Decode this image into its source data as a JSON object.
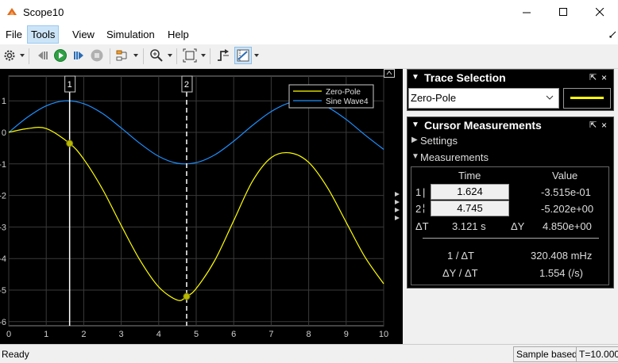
{
  "window": {
    "title": "Scope10"
  },
  "menu": [
    "File",
    "Tools",
    "View",
    "Simulation",
    "Help"
  ],
  "plot": {
    "legend": [
      "Zero-Pole",
      "Sine Wave4"
    ],
    "x_ticks": [
      "0",
      "1",
      "2",
      "3",
      "4",
      "5",
      "6",
      "7",
      "8",
      "9",
      "10"
    ],
    "y_ticks": [
      "1",
      "0",
      "-1",
      "-2",
      "-3",
      "-4",
      "-5",
      "-6"
    ],
    "cursor1_label": "1",
    "cursor2_label": "2",
    "series_colors": {
      "zero_pole": "#ffff00",
      "sine": "#1e90ff"
    }
  },
  "chart_data": {
    "type": "line",
    "xlim": [
      0,
      10
    ],
    "ylim": [
      -6.1,
      1.5
    ],
    "legend_position": "top-right",
    "grid": true,
    "series": [
      {
        "name": "Zero-Pole",
        "color": "#ffff00",
        "x": [
          0,
          0.5,
          1.0,
          1.624,
          2.0,
          2.5,
          3.0,
          3.5,
          4.0,
          4.5,
          4.745,
          5.0,
          5.5,
          6.0,
          6.5,
          7.0,
          7.5,
          8.0,
          8.5,
          9.0,
          9.5,
          10.0
        ],
        "values": [
          0,
          0.12,
          0.12,
          -0.35,
          -0.85,
          -1.8,
          -2.95,
          -4.05,
          -4.9,
          -5.32,
          -5.2,
          -4.95,
          -4.05,
          -2.8,
          -1.55,
          -0.8,
          -0.65,
          -0.95,
          -1.75,
          -2.85,
          -3.95,
          -4.8
        ]
      },
      {
        "name": "Sine Wave4",
        "color": "#1e90ff",
        "x": [
          0,
          0.5,
          1.0,
          1.5,
          2.0,
          2.5,
          3.0,
          3.5,
          4.0,
          4.5,
          5.0,
          5.5,
          6.0,
          6.5,
          7.0,
          7.5,
          8.0,
          8.5,
          9.0,
          9.5,
          10.0
        ],
        "values": [
          0,
          0.48,
          0.84,
          1.0,
          0.91,
          0.6,
          0.14,
          -0.35,
          -0.76,
          -0.98,
          -0.96,
          -0.71,
          -0.28,
          0.22,
          0.66,
          0.94,
          0.99,
          0.8,
          0.41,
          -0.08,
          -0.54
        ]
      }
    ],
    "cursors": [
      {
        "id": "1",
        "x": 1.624,
        "y": -0.3515
      },
      {
        "id": "2",
        "x": 4.745,
        "y": -5.202
      }
    ]
  },
  "trace_selection": {
    "title": "Trace Selection",
    "selected": "Zero-Pole",
    "color": "#ffff00"
  },
  "cursor_measurements": {
    "title": "Cursor Measurements",
    "settings_label": "Settings",
    "measurements_label": "Measurements",
    "col_time": "Time",
    "col_value": "Value",
    "rows": [
      {
        "id": "1",
        "time": "1.624",
        "value": "-3.515e-01"
      },
      {
        "id": "2",
        "time": "4.745",
        "value": "-5.202e+00"
      }
    ],
    "delta_t_label": "ΔT",
    "delta_t": "3.121 s",
    "delta_y_label": "ΔY",
    "delta_y": "4.850e+00",
    "inv_dt_label": "1 / ΔT",
    "inv_dt": "320.408 mHz",
    "dy_dt_label": "ΔY / ΔT",
    "dy_dt": "1.554 (/s)"
  },
  "status": {
    "left": "Ready",
    "mode": "Sample based",
    "time": "T=10.000"
  }
}
